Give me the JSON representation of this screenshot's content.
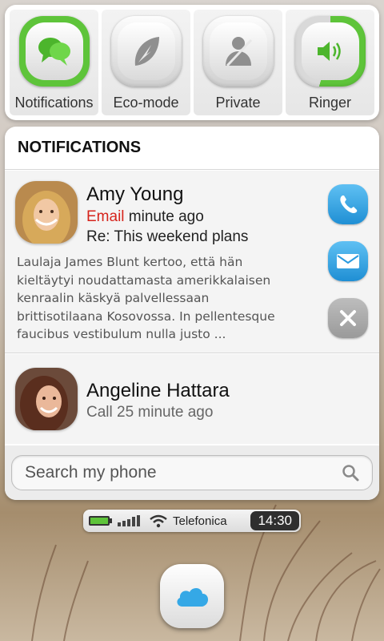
{
  "quick_settings": [
    {
      "label": "Notifications",
      "icon": "speech-bubbles-icon",
      "state": "on"
    },
    {
      "label": "Eco-mode",
      "icon": "leaf-icon",
      "state": "off"
    },
    {
      "label": "Private",
      "icon": "private-person-icon",
      "state": "off"
    },
    {
      "label": "Ringer",
      "icon": "speaker-icon",
      "state": "on",
      "level": 0.55
    }
  ],
  "notifications": {
    "title": "NOTIFICATIONS",
    "items": [
      {
        "name": "Amy Young",
        "type": "Email",
        "time": "minute ago",
        "subject": "Re: This weekend plans",
        "body": "Laulaja James Blunt kertoo, että hän kieltäytyi noudattamasta amerikkalaisen kenraalin käskyä palvellessaan brittisotilaana Kosovossa. In pellentesque faucibus vestibulum nulla justo ...",
        "actions": [
          "call-icon",
          "mail-icon",
          "dismiss-icon"
        ]
      },
      {
        "name": "Angeline Hattara",
        "meta": "Call 25 minute ago"
      }
    ]
  },
  "search": {
    "placeholder": "Search my phone"
  },
  "status_bar": {
    "carrier": "Telefonica",
    "time": "14:30"
  },
  "dock": {
    "icon": "cloud-icon"
  },
  "colors": {
    "accent_green": "#5ec43a",
    "action_blue": "#2a9be0",
    "email_red": "#d6241c"
  }
}
